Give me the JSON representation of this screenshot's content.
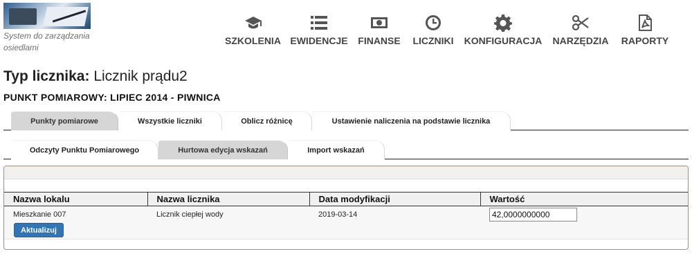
{
  "header": {
    "logo_caption": "System do zarządzania osiedlami",
    "nav": [
      {
        "label": "SZKOLENIA",
        "icon": "graduation-cap-icon"
      },
      {
        "label": "EWIDENCJE",
        "icon": "list-icon"
      },
      {
        "label": "FINANSE",
        "icon": "money-icon"
      },
      {
        "label": "LICZNIKI",
        "icon": "clock-icon"
      },
      {
        "label": "KONFIGURACJA",
        "icon": "gear-icon"
      },
      {
        "label": "NARZĘDZIA",
        "icon": "scissors-icon"
      },
      {
        "label": "RAPORTY",
        "icon": "pdf-file-icon"
      }
    ]
  },
  "page": {
    "title_prefix": "Typ licznika:",
    "title_value": "Licznik prądu2",
    "subtitle": "PUNKT POMIAROWY: LIPIEC 2014 - PIWNICA"
  },
  "tabs_main": [
    {
      "label": "Punkty pomiarowe",
      "active": true
    },
    {
      "label": "Wszystkie liczniki",
      "active": false
    },
    {
      "label": "Oblicz różnicę",
      "active": false
    },
    {
      "label": "Ustawienie naliczenia na podstawie licznika",
      "active": false
    }
  ],
  "tabs_sub": [
    {
      "label": "Odczyty Punktu Pomiarowego",
      "active": false
    },
    {
      "label": "Hurtowa edycja wskazań",
      "active": true
    },
    {
      "label": "Import wskazań",
      "active": false
    }
  ],
  "table": {
    "columns": [
      "Nazwa lokalu",
      "Nazwa licznika",
      "Data modyfikacji",
      "Wartość"
    ],
    "rows": [
      {
        "lokal": "Mieszkanie 007",
        "licznik": "Licznik ciepłej wody",
        "data": "2019-03-14",
        "wartosc": "42,0000000000"
      }
    ]
  },
  "actions": {
    "update_label": "Aktualizuj"
  },
  "colors": {
    "button": "#3275b4",
    "active_tab": "#d6d6d6"
  }
}
